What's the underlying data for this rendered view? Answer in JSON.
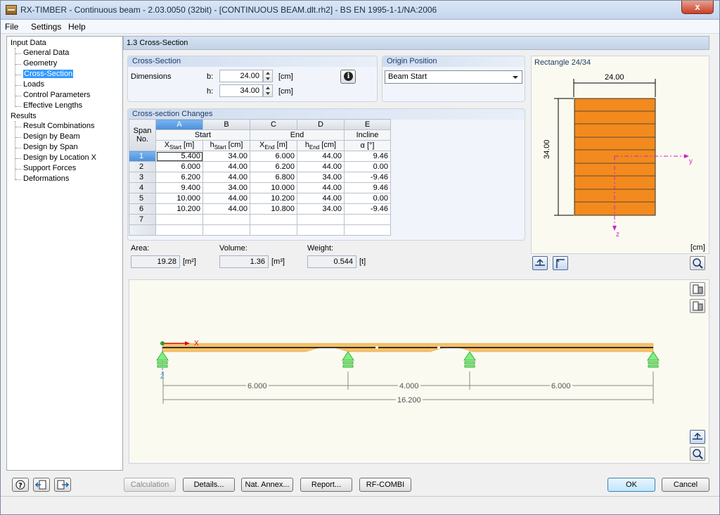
{
  "window": {
    "title": "RX-TIMBER - Continuous beam - 2.03.0050 (32bit) - [CONTINUOUS BEAM.dlt.rh2] - BS EN 1995-1-1/NA:2006",
    "close_label": "x"
  },
  "menu": [
    "File",
    "Settings",
    "Help"
  ],
  "tree": {
    "input_header": "Input Data",
    "input_items": [
      "General Data",
      "Geometry",
      "Cross-Section",
      "Loads",
      "Control Parameters",
      "Effective Lengths"
    ],
    "selected_index": 2,
    "results_header": "Results",
    "result_items": [
      "Result Combinations",
      "Design by Beam",
      "Design by Span",
      "Design by Location X",
      "Support Forces",
      "Deformations"
    ]
  },
  "page_title": "1.3 Cross-Section",
  "cross_section": {
    "title": "Cross-Section",
    "dimensions_label": "Dimensions",
    "b_label": "b:",
    "b_value": "24.00",
    "b_unit": "[cm]",
    "h_label": "h:",
    "h_value": "34.00",
    "h_unit": "[cm]"
  },
  "origin": {
    "title": "Origin Position",
    "selected": "Beam Start"
  },
  "changes": {
    "title": "Cross-section Changes",
    "col_letters": [
      "A",
      "B",
      "C",
      "D",
      "E"
    ],
    "span_label_1": "Span",
    "span_label_2": "No.",
    "group_start": "Start",
    "group_end": "End",
    "group_incline": "Incline",
    "sub_x_start": "X",
    "sub_x_start_sub": "Start",
    "sub_x_start_unit": " [m]",
    "sub_h_start": "h",
    "sub_h_start_sub": "Start",
    "sub_h_start_unit": " [cm]",
    "sub_x_end": "X",
    "sub_x_end_sub": "End",
    "sub_x_end_unit": " [m]",
    "sub_h_end": "h",
    "sub_h_end_sub": "End",
    "sub_h_end_unit": " [cm]",
    "sub_alpha": "α [°]",
    "rows": [
      {
        "no": "1",
        "xs": "5.400",
        "hs": "34.00",
        "xe": "6.000",
        "he": "44.00",
        "a": "9.46"
      },
      {
        "no": "2",
        "xs": "6.000",
        "hs": "44.00",
        "xe": "6.200",
        "he": "44.00",
        "a": "0.00"
      },
      {
        "no": "3",
        "xs": "6.200",
        "hs": "44.00",
        "xe": "6.800",
        "he": "34.00",
        "a": "-9.46"
      },
      {
        "no": "4",
        "xs": "9.400",
        "hs": "34.00",
        "xe": "10.000",
        "he": "44.00",
        "a": "9.46"
      },
      {
        "no": "5",
        "xs": "10.000",
        "hs": "44.00",
        "xe": "10.200",
        "he": "44.00",
        "a": "0.00"
      },
      {
        "no": "6",
        "xs": "10.200",
        "hs": "44.00",
        "xe": "10.800",
        "he": "34.00",
        "a": "-9.46"
      },
      {
        "no": "7",
        "xs": "",
        "hs": "",
        "xe": "",
        "he": "",
        "a": ""
      },
      {
        "no": "",
        "xs": "",
        "hs": "",
        "xe": "",
        "he": "",
        "a": ""
      }
    ]
  },
  "summary": {
    "area_label": "Area:",
    "area_value": "19.28",
    "area_unit": "[m²]",
    "volume_label": "Volume:",
    "volume_value": "1.36",
    "volume_unit": "[m³]",
    "weight_label": "Weight:",
    "weight_value": "0.544",
    "weight_unit": "[t]"
  },
  "section_preview": {
    "title": "Rectangle 24/34",
    "width_label": "24.00",
    "height_label": "34.00",
    "y_label": "y",
    "z_label": "z",
    "unit_label": "[cm]",
    "fill_color": "#f28a1e"
  },
  "beam_view": {
    "x_label": "X",
    "z_label": "Z",
    "span_labels": [
      "6.000",
      "4.000",
      "6.000"
    ],
    "total_label": "16.200",
    "beam_color": "#f5c16b"
  },
  "buttons": {
    "calculation": "Calculation",
    "details": "Details...",
    "nat_annex": "Nat. Annex...",
    "report": "Report...",
    "rf_combi": "RF-COMBI",
    "ok": "OK",
    "cancel": "Cancel"
  }
}
